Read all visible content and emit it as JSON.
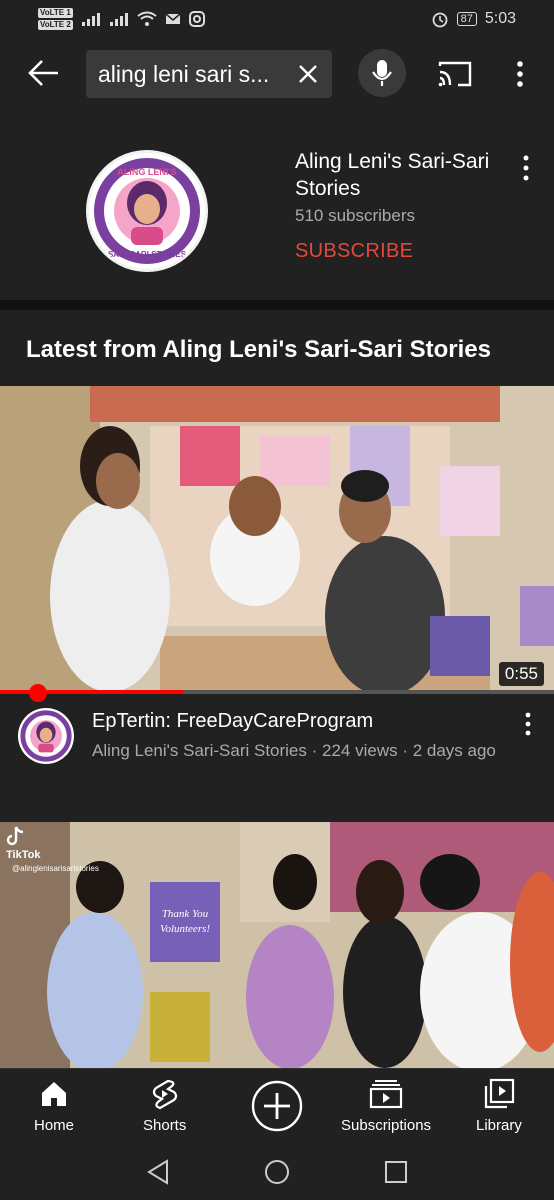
{
  "status_bar": {
    "volte1": "VoLTE 1",
    "volte2": "VoLTE 2",
    "battery": "87",
    "time": "5:03"
  },
  "search": {
    "query": "aling leni sari s..."
  },
  "channel": {
    "name": "Aling Leni's Sari-Sari Stories",
    "subscribers": "510 subscribers",
    "subscribe_label": "SUBSCRIBE",
    "logo_text_top": "ALING LENI'S",
    "logo_text_bottom": "SARI-SARI STORIES"
  },
  "section": {
    "title": "Latest from Aling Leni's Sari-Sari Stories"
  },
  "videos": [
    {
      "title": "EpTertin: FreeDayCareProgram",
      "meta": "Aling Leni's Sari-Sari Stories · 224 views · 2 days ago",
      "duration": "0:55",
      "progress": 0.33
    },
    {
      "watermark": "TikTok",
      "handle": "@alinglenisarisaristories",
      "poster_text": "Thank You Volunteers!"
    }
  ],
  "bottom_nav": {
    "items": [
      {
        "label": "Home",
        "icon": "home-icon"
      },
      {
        "label": "Shorts",
        "icon": "shorts-icon"
      },
      {
        "label": "",
        "icon": "create-icon"
      },
      {
        "label": "Subscriptions",
        "icon": "subscriptions-icon"
      },
      {
        "label": "Library",
        "icon": "library-icon"
      }
    ]
  },
  "colors": {
    "background": "#212121",
    "subscribe": "#e5483b",
    "progress": "#ff0000",
    "logo_ring": "#7b3fa0"
  }
}
